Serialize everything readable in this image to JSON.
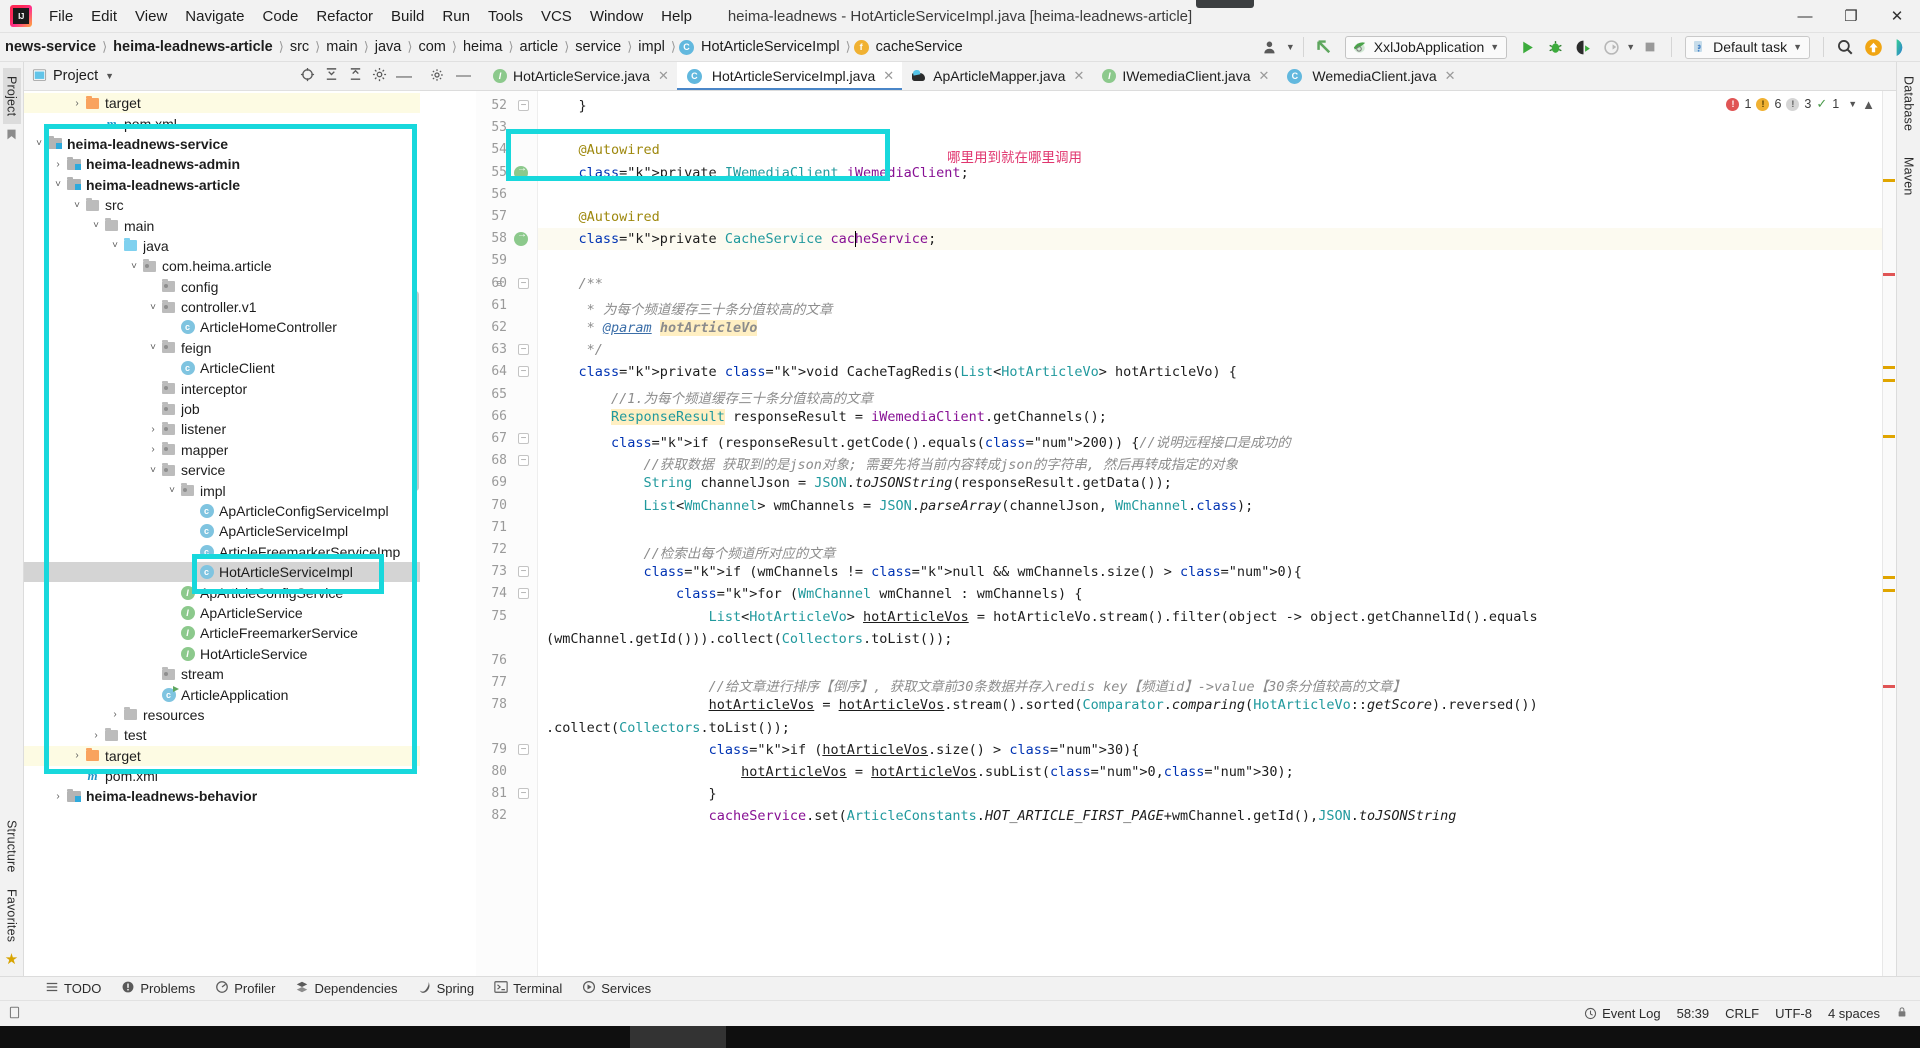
{
  "window": {
    "title": "heima-leadnews - HotArticleServiceImpl.java [heima-leadnews-article]",
    "minimize": "—",
    "maximize": "❐",
    "close": "✕"
  },
  "menu": [
    "File",
    "Edit",
    "View",
    "Navigate",
    "Code",
    "Refactor",
    "Build",
    "Run",
    "Tools",
    "VCS",
    "Window",
    "Help"
  ],
  "breadcrumb": [
    {
      "label": "news-service",
      "bold": true,
      "icon": ""
    },
    {
      "label": "heima-leadnews-article",
      "bold": true,
      "icon": ""
    },
    {
      "label": "src",
      "bold": false,
      "icon": ""
    },
    {
      "label": "main",
      "bold": false,
      "icon": ""
    },
    {
      "label": "java",
      "bold": false,
      "icon": ""
    },
    {
      "label": "com",
      "bold": false,
      "icon": ""
    },
    {
      "label": "heima",
      "bold": false,
      "icon": ""
    },
    {
      "label": "article",
      "bold": false,
      "icon": ""
    },
    {
      "label": "service",
      "bold": false,
      "icon": ""
    },
    {
      "label": "impl",
      "bold": false,
      "icon": ""
    },
    {
      "label": "HotArticleServiceImpl",
      "bold": false,
      "icon": "class-icon"
    },
    {
      "label": "cacheService",
      "bold": false,
      "icon": "field-icon"
    }
  ],
  "toolbar": {
    "run_config": "XxlJobApplication",
    "task_config": "Default task",
    "run_label": "Run",
    "debug_label": "Debug",
    "run_coverage_label": "Run with Coverage",
    "profile_label": "Profile",
    "stop_label": "Stop",
    "search_label": "Search Everywhere",
    "updates_label": "Updates",
    "ide_label": "IDE Assistant"
  },
  "project_panel": {
    "title": "Project",
    "vertical_tabs_left": [
      "Project",
      "Structure",
      "Favorites"
    ],
    "vertical_tabs_right": [
      "Database",
      "Maven"
    ],
    "tree": [
      {
        "label": "target",
        "depth": 3,
        "arrow": "right",
        "icon": "folder-orange",
        "bold": false,
        "state": "hl"
      },
      {
        "label": "pom.xml",
        "depth": 4,
        "arrow": "",
        "icon": "maven",
        "bold": false,
        "state": ""
      },
      {
        "label": "heima-leadnews-service",
        "depth": 1,
        "arrow": "down",
        "icon": "module",
        "bold": true,
        "state": ""
      },
      {
        "label": "heima-leadnews-admin",
        "depth": 2,
        "arrow": "right",
        "icon": "module",
        "bold": true,
        "state": ""
      },
      {
        "label": "heima-leadnews-article",
        "depth": 2,
        "arrow": "down",
        "icon": "module",
        "bold": true,
        "state": ""
      },
      {
        "label": "src",
        "depth": 3,
        "arrow": "down",
        "icon": "folder-plain",
        "bold": false,
        "state": ""
      },
      {
        "label": "main",
        "depth": 4,
        "arrow": "down",
        "icon": "folder-plain",
        "bold": false,
        "state": ""
      },
      {
        "label": "java",
        "depth": 5,
        "arrow": "down",
        "icon": "folder-blue",
        "bold": false,
        "state": ""
      },
      {
        "label": "com.heima.article",
        "depth": 6,
        "arrow": "down",
        "icon": "package",
        "bold": false,
        "state": ""
      },
      {
        "label": "config",
        "depth": 7,
        "arrow": "",
        "icon": "package",
        "bold": false,
        "state": ""
      },
      {
        "label": "controller.v1",
        "depth": 7,
        "arrow": "down",
        "icon": "package",
        "bold": false,
        "state": ""
      },
      {
        "label": "ArticleHomeController",
        "depth": 8,
        "arrow": "",
        "icon": "class",
        "bold": false,
        "state": ""
      },
      {
        "label": "feign",
        "depth": 7,
        "arrow": "down",
        "icon": "package",
        "bold": false,
        "state": ""
      },
      {
        "label": "ArticleClient",
        "depth": 8,
        "arrow": "",
        "icon": "class",
        "bold": false,
        "state": ""
      },
      {
        "label": "interceptor",
        "depth": 7,
        "arrow": "",
        "icon": "package",
        "bold": false,
        "state": ""
      },
      {
        "label": "job",
        "depth": 7,
        "arrow": "",
        "icon": "package",
        "bold": false,
        "state": ""
      },
      {
        "label": "listener",
        "depth": 7,
        "arrow": "right",
        "icon": "package",
        "bold": false,
        "state": ""
      },
      {
        "label": "mapper",
        "depth": 7,
        "arrow": "right",
        "icon": "package",
        "bold": false,
        "state": ""
      },
      {
        "label": "service",
        "depth": 7,
        "arrow": "down",
        "icon": "package",
        "bold": false,
        "state": ""
      },
      {
        "label": "impl",
        "depth": 8,
        "arrow": "down",
        "icon": "package",
        "bold": false,
        "state": ""
      },
      {
        "label": "ApArticleConfigServiceImpl",
        "depth": 9,
        "arrow": "",
        "icon": "class",
        "bold": false,
        "state": ""
      },
      {
        "label": "ApArticleServiceImpl",
        "depth": 9,
        "arrow": "",
        "icon": "class",
        "bold": false,
        "state": ""
      },
      {
        "label": "ArticleFreemarkerServiceImp",
        "depth": 9,
        "arrow": "",
        "icon": "class",
        "bold": false,
        "state": ""
      },
      {
        "label": "HotArticleServiceImpl",
        "depth": 9,
        "arrow": "",
        "icon": "class",
        "bold": false,
        "state": "sel"
      },
      {
        "label": "ApArticleConfigService",
        "depth": 8,
        "arrow": "",
        "icon": "interface",
        "bold": false,
        "state": ""
      },
      {
        "label": "ApArticleService",
        "depth": 8,
        "arrow": "",
        "icon": "interface",
        "bold": false,
        "state": ""
      },
      {
        "label": "ArticleFreemarkerService",
        "depth": 8,
        "arrow": "",
        "icon": "interface",
        "bold": false,
        "state": ""
      },
      {
        "label": "HotArticleService",
        "depth": 8,
        "arrow": "",
        "icon": "interface",
        "bold": false,
        "state": ""
      },
      {
        "label": "stream",
        "depth": 7,
        "arrow": "",
        "icon": "package",
        "bold": false,
        "state": ""
      },
      {
        "label": "ArticleApplication",
        "depth": 7,
        "arrow": "",
        "icon": "spring-app",
        "bold": false,
        "state": ""
      },
      {
        "label": "resources",
        "depth": 5,
        "arrow": "right",
        "icon": "folder-plain",
        "bold": false,
        "state": ""
      },
      {
        "label": "test",
        "depth": 4,
        "arrow": "right",
        "icon": "folder-plain",
        "bold": false,
        "state": ""
      },
      {
        "label": "target",
        "depth": 3,
        "arrow": "right",
        "icon": "folder-orange",
        "bold": false,
        "state": "hl"
      },
      {
        "label": "pom.xml",
        "depth": 3,
        "arrow": "",
        "icon": "maven",
        "bold": false,
        "state": ""
      },
      {
        "label": "heima-leadnews-behavior",
        "depth": 2,
        "arrow": "right",
        "icon": "module",
        "bold": true,
        "state": ""
      }
    ]
  },
  "editor": {
    "tabs": [
      {
        "label": "HotArticleService.java",
        "icon": "interface-icon",
        "active": false
      },
      {
        "label": "HotArticleServiceImpl.java",
        "icon": "class-icon",
        "active": true
      },
      {
        "label": "ApArticleMapper.java",
        "icon": "mapper-icon",
        "active": false
      },
      {
        "label": "IWemediaClient.java",
        "icon": "interface-icon",
        "active": false
      },
      {
        "label": "WemediaClient.java",
        "icon": "class-icon",
        "active": false
      }
    ],
    "inspection": {
      "errors": "1",
      "warnings": "6",
      "weak_warnings": "3",
      "typos": "1",
      "ok_glyph": "✓"
    },
    "annotation_note": "哪里用到就在哪里调用",
    "first_line_number": 52,
    "lines": [
      {
        "n": 52,
        "fold": "minus",
        "text": "    }"
      },
      {
        "n": 53,
        "fold": "",
        "text": ""
      },
      {
        "n": 54,
        "fold": "",
        "text": "    @Autowired"
      },
      {
        "n": 55,
        "fold": "",
        "bean": true,
        "text": "    private IWemediaClient iWemediaClient;"
      },
      {
        "n": 56,
        "fold": "",
        "text": ""
      },
      {
        "n": 57,
        "fold": "",
        "text": "    @Autowired"
      },
      {
        "n": 58,
        "fold": "",
        "bean": true,
        "current": true,
        "text": "    private CacheService cacheService;"
      },
      {
        "n": 59,
        "fold": "",
        "text": ""
      },
      {
        "n": 60,
        "fold": "minus",
        "doc": true,
        "text": "    /**"
      },
      {
        "n": 61,
        "fold": "",
        "text": "     * 为每个频道缓存三十条分值较高的文章"
      },
      {
        "n": 62,
        "fold": "",
        "text": "     * @param hotArticleVo"
      },
      {
        "n": 63,
        "fold": "minus",
        "text": "     */"
      },
      {
        "n": 64,
        "fold": "minus",
        "text": "    private void CacheTagRedis(List<HotArticleVo> hotArticleVo) {"
      },
      {
        "n": 65,
        "fold": "",
        "text": "        //1.为每个频道缓存三十条分值较高的文章"
      },
      {
        "n": 66,
        "fold": "",
        "text": "        ResponseResult responseResult = iWemediaClient.getChannels();"
      },
      {
        "n": 67,
        "fold": "minus",
        "text": "        if (responseResult.getCode().equals(200)) {//说明远程接口是成功的"
      },
      {
        "n": 68,
        "fold": "minus",
        "text": "            //获取数据 获取到的是json对象; 需要先将当前内容转成json的字符串, 然后再转成指定的对象"
      },
      {
        "n": 69,
        "fold": "",
        "text": "            String channelJson = JSON.toJSONString(responseResult.getData());"
      },
      {
        "n": 70,
        "fold": "",
        "text": "            List<WmChannel> wmChannels = JSON.parseArray(channelJson, WmChannel.class);"
      },
      {
        "n": 71,
        "fold": "",
        "text": ""
      },
      {
        "n": 72,
        "fold": "",
        "text": "            //检索出每个频道所对应的文章"
      },
      {
        "n": 73,
        "fold": "minus",
        "text": "            if (wmChannels != null && wmChannels.size() > 0){"
      },
      {
        "n": 74,
        "fold": "minus",
        "text": "                for (WmChannel wmChannel : wmChannels) {"
      },
      {
        "n": 75,
        "fold": "",
        "text": "                    List<HotArticleVo> hotArticleVos = hotArticleVo.stream().filter(object -> object.getChannelId().equals"
      },
      {
        "n": "",
        "fold": "",
        "cont": true,
        "text": "(wmChannel.getId())).collect(Collectors.toList());"
      },
      {
        "n": 76,
        "fold": "",
        "text": ""
      },
      {
        "n": 77,
        "fold": "",
        "text": "                    //给文章进行排序【倒序】, 获取文章前30条数据并存入redis key【频道id】->value【30条分值较高的文章】"
      },
      {
        "n": 78,
        "fold": "",
        "text": "                    hotArticleVos = hotArticleVos.stream().sorted(Comparator.comparing(HotArticleVo::getScore).reversed())"
      },
      {
        "n": "",
        "fold": "",
        "cont": true,
        "text": ".collect(Collectors.toList());"
      },
      {
        "n": 79,
        "fold": "minus",
        "text": "                    if (hotArticleVos.size() > 30){"
      },
      {
        "n": 80,
        "fold": "",
        "text": "                        hotArticleVos = hotArticleVos.subList(0,30);"
      },
      {
        "n": 81,
        "fold": "minus",
        "text": "                    }"
      },
      {
        "n": 82,
        "fold": "",
        "text": "                    cacheService.set(ArticleConstants.HOT_ARTICLE_FIRST_PAGE+wmChannel.getId(),JSON.toJSONString"
      }
    ]
  },
  "tool_windows": [
    {
      "label": "TODO",
      "icon": "todo-icon"
    },
    {
      "label": "Problems",
      "icon": "problems-icon"
    },
    {
      "label": "Profiler",
      "icon": "profiler-icon"
    },
    {
      "label": "Dependencies",
      "icon": "dependencies-icon"
    },
    {
      "label": "Spring",
      "icon": "spring-icon"
    },
    {
      "label": "Terminal",
      "icon": "terminal-icon"
    },
    {
      "label": "Services",
      "icon": "services-icon"
    }
  ],
  "statusbar": {
    "event_log": "Event Log",
    "caret_position": "58:39",
    "line_separator": "CRLF",
    "encoding": "UTF-8",
    "indent": "4 spaces",
    "lock": "🔒"
  },
  "colors": {
    "annotation_cyan": "#18d8dc",
    "note_pink": "#e0356e",
    "accent_blue": "#4a86c8",
    "selection_gray": "#d4d4d4"
  }
}
